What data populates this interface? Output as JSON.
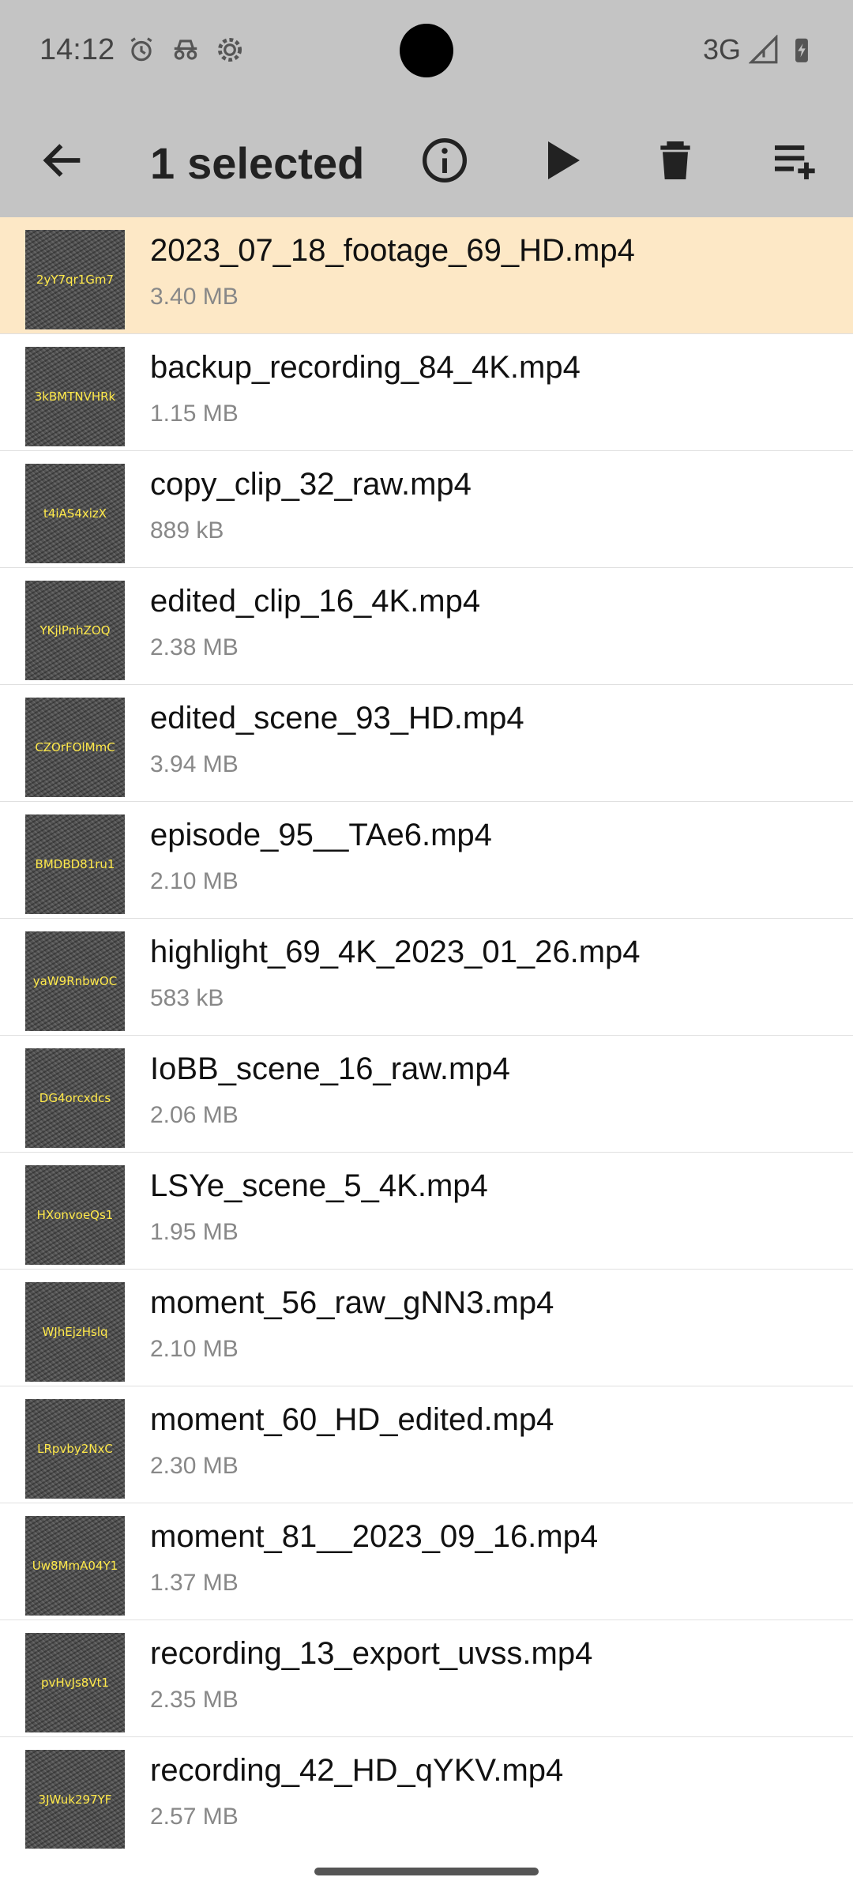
{
  "status_bar": {
    "time": "14:12",
    "network": "3G"
  },
  "toolbar": {
    "selected_count": "1",
    "selected_label": "selected"
  },
  "files": [
    {
      "name": "2023_07_18_footage_69_HD.mp4",
      "size": "3.40 MB",
      "thumb": "2yY7qr1Gm7",
      "selected": true
    },
    {
      "name": "backup_recording_84_4K.mp4",
      "size": "1.15 MB",
      "thumb": "3kBMTNVHRk",
      "selected": false
    },
    {
      "name": "copy_clip_32_raw.mp4",
      "size": "889 kB",
      "thumb": "t4iAS4xizX",
      "selected": false
    },
    {
      "name": "edited_clip_16_4K.mp4",
      "size": "2.38 MB",
      "thumb": "YKjlPnhZOQ",
      "selected": false
    },
    {
      "name": "edited_scene_93_HD.mp4",
      "size": "3.94 MB",
      "thumb": "CZOrFOlMmC",
      "selected": false
    },
    {
      "name": "episode_95__TAe6.mp4",
      "size": "2.10 MB",
      "thumb": "BMDBD81ru1",
      "selected": false
    },
    {
      "name": "highlight_69_4K_2023_01_26.mp4",
      "size": "583 kB",
      "thumb": "yaW9RnbwOC",
      "selected": false
    },
    {
      "name": "IoBB_scene_16_raw.mp4",
      "size": "2.06 MB",
      "thumb": "DG4orcxdcs",
      "selected": false
    },
    {
      "name": "LSYe_scene_5_4K.mp4",
      "size": "1.95 MB",
      "thumb": "HXonvoeQs1",
      "selected": false
    },
    {
      "name": "moment_56_raw_gNN3.mp4",
      "size": "2.10 MB",
      "thumb": "WJhEjzHslq",
      "selected": false
    },
    {
      "name": "moment_60_HD_edited.mp4",
      "size": "2.30 MB",
      "thumb": "LRpvby2NxC",
      "selected": false
    },
    {
      "name": "moment_81__2023_09_16.mp4",
      "size": "1.37 MB",
      "thumb": "Uw8MmA04Y1",
      "selected": false
    },
    {
      "name": "recording_13_export_uvss.mp4",
      "size": "2.35 MB",
      "thumb": "pvHvJs8Vt1",
      "selected": false
    },
    {
      "name": "recording_42_HD_qYKV.mp4",
      "size": "2.57 MB",
      "thumb": "3JWuk297YF",
      "selected": false
    }
  ],
  "colors": {
    "app_bar": "#c4c4c4",
    "selected_row": "#fde8c6",
    "thumb_text": "#ffe94a"
  }
}
